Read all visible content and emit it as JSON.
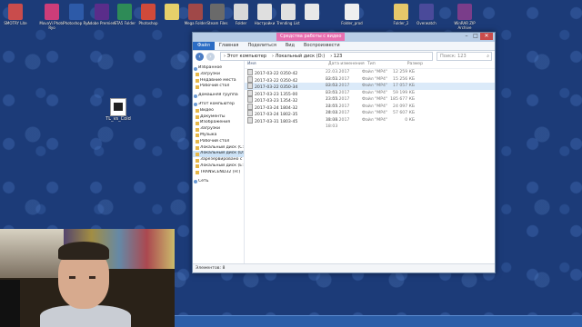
{
  "desktop_icons": [
    {
      "label": "SMOTRY Lite",
      "color": "#c94c4c"
    },
    {
      "label": "MovaVi Photo Ryo",
      "color": "#cc3d79"
    },
    {
      "label": "Photoshop Ryo",
      "color": "#2d5aa8"
    },
    {
      "label": "Adobe Premiere",
      "color": "#5a2d8a"
    },
    {
      "label": "GTA5 Folder",
      "color": "#2e8b57"
    },
    {
      "label": "Photoshop",
      "color": "#d04a3a"
    },
    {
      "label": "",
      "color": "#e6d06a"
    },
    {
      "label": "Mega Folder",
      "color": "#a04848"
    },
    {
      "label": "Steam Files",
      "color": "#6a6a6a"
    },
    {
      "label": "Folder",
      "color": "#d8d8d8"
    },
    {
      "label": "Настройки",
      "color": "#dfdfdf"
    },
    {
      "label": "Trending List",
      "color": "#e0e0e0"
    },
    {
      "label": "",
      "color": "#e8e8e8"
    },
    {
      "label": "Folder_prod",
      "color": "#efefef"
    },
    {
      "label": "Folder_2",
      "color": "#e6c86a"
    },
    {
      "label": "Overwatch",
      "color": "#4a4a9a"
    },
    {
      "label": "WinRAR ZIP Archive",
      "color": "#7a3d8a"
    }
  ],
  "desktop_file": {
    "label": "TL_vs_Cold"
  },
  "window": {
    "context_tab": "Средства работы с видео",
    "ribbon_tabs": [
      "Файл",
      "Главная",
      "Поделиться",
      "Вид",
      "Воспроизвести"
    ],
    "path": [
      "Этот компьютер",
      "Локальный диск (D:)",
      "123"
    ],
    "search_placeholder": "Поиск: 123",
    "nav_items": [
      {
        "label": "Избранное",
        "group": true
      },
      {
        "label": "Загрузки",
        "group": false
      },
      {
        "label": "Недавние места",
        "group": false
      },
      {
        "label": "Рабочий стол",
        "group": false
      },
      {
        "label": "Домашняя группа",
        "group": true
      },
      {
        "label": "Этот компьютер",
        "group": true
      },
      {
        "label": "Видео",
        "group": false
      },
      {
        "label": "Документы",
        "group": false
      },
      {
        "label": "Изображения",
        "group": false
      },
      {
        "label": "Загрузки",
        "group": false
      },
      {
        "label": "Музыка",
        "group": false
      },
      {
        "label": "Рабочий стол",
        "group": false
      },
      {
        "label": "Локальный диск (C:)",
        "group": false
      },
      {
        "label": "Локальный диск (D:)",
        "group": false,
        "selected": true
      },
      {
        "label": "Зарезервировано с",
        "group": false
      },
      {
        "label": "Локальный диск (E:)",
        "group": false
      },
      {
        "label": "TRANSCEND32 (H:)",
        "group": false
      },
      {
        "label": "Сеть",
        "group": true
      }
    ],
    "columns": [
      "Имя",
      "Дата изменения",
      "Тип",
      "Размер"
    ],
    "files": [
      {
        "name": "2017-03-22 0350-42",
        "date": "22.03.2017 03:51",
        "type": "Файл \"MP4\"",
        "size": "12 259 КБ"
      },
      {
        "name": "2017-03-22 0350-42",
        "date": "22.03.2017 03:52",
        "type": "Файл \"MP4\"",
        "size": "15 256 КБ"
      },
      {
        "name": "2017-03-22 0350-34",
        "date": "22.03.2017 03:51",
        "type": "Файл \"MP4\"",
        "size": "17 057 КБ"
      },
      {
        "name": "2017-03-23 1355-00",
        "date": "23.03.2017 13:55",
        "type": "Файл \"MP4\"",
        "size": "59 199 КБ"
      },
      {
        "name": "2017-03-23 1354-32",
        "date": "23.03.2017 13:55",
        "type": "Файл \"MP4\"",
        "size": "185 677 КБ"
      },
      {
        "name": "2017-03-24 1804-32",
        "date": "24.03.2017 18:04",
        "type": "Файл \"MP4\"",
        "size": "24 097 КБ"
      },
      {
        "name": "2017-03-24 1802-35",
        "date": "24.03.2017 18:36",
        "type": "Файл \"MP4\"",
        "size": "57 607 КБ"
      },
      {
        "name": "2017-03-31 1803-45",
        "date": "31.03.2017 18:03",
        "type": "Файл \"MP4\"",
        "size": "0 КБ"
      }
    ],
    "highlighted_row": 2,
    "status": "Элементов: 8"
  }
}
